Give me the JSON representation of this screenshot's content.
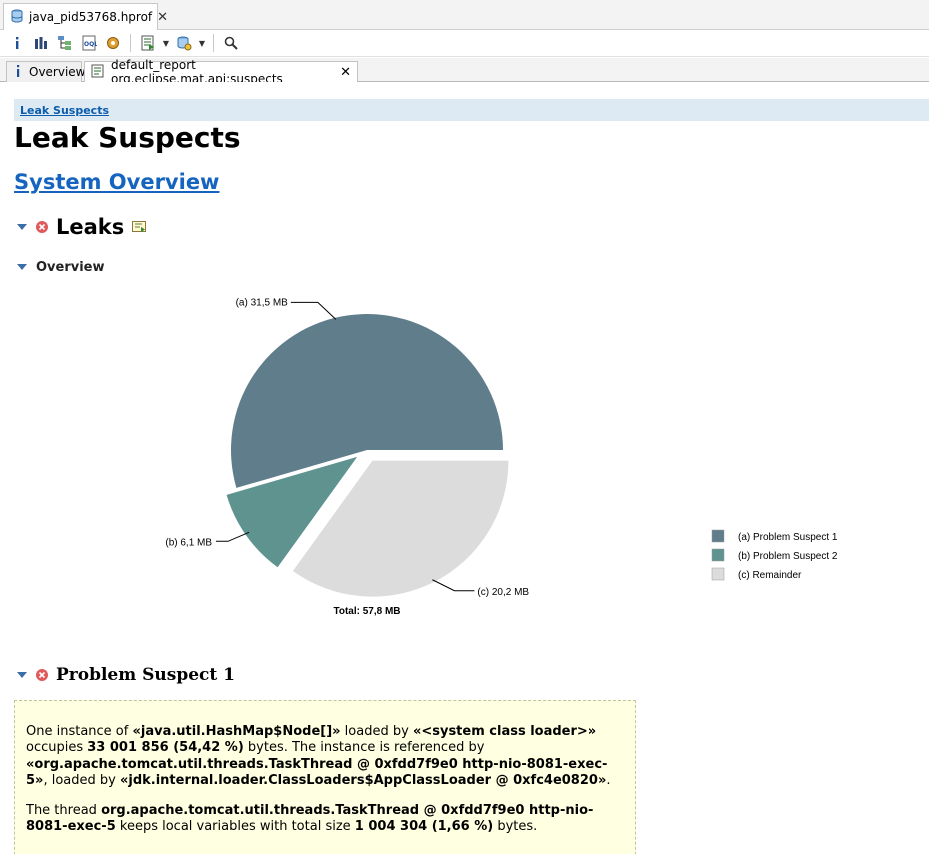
{
  "editor_tab": {
    "label": "java_pid53768.hprof",
    "close_glyph": "✕"
  },
  "toolbar": {
    "buttons": [
      "info-icon",
      "histogram-icon",
      "dominator-tree-icon",
      "oql-icon",
      "thread-overview-icon",
      "run-report-icon",
      "query-browser-icon",
      "search-icon"
    ]
  },
  "subtabs": [
    {
      "label": "Overview"
    },
    {
      "label": "default_report org.eclipse.mat.api:suspects"
    }
  ],
  "breadcrumb": "Leak Suspects",
  "page_title": "Leak Suspects",
  "system_overview_link": "System Overview",
  "sections": {
    "leaks": "Leaks",
    "overview": "Overview",
    "problem_suspect_1": "Problem Suspect 1"
  },
  "colors": {
    "suspect1": "#607d8b",
    "suspect2": "#5f9390",
    "remainder": "#dcdcdc",
    "link": "#1565c0",
    "info_box": "#ffffe1",
    "error_icon": "#e05a5a"
  },
  "chart_data": {
    "type": "pie",
    "slices": [
      {
        "key": "(a)",
        "name": "Problem Suspect 1",
        "value": 31.5,
        "label": "31,5 MB"
      },
      {
        "key": "(b)",
        "name": "Problem Suspect 2",
        "value": 6.1,
        "label": "6,1 MB"
      },
      {
        "key": "(c)",
        "name": "Remainder",
        "value": 20.2,
        "label": "20,2 MB"
      }
    ],
    "total_label": "Total: 57,8 MB",
    "legend": [
      "(a)  Problem Suspect 1",
      "(b)  Problem Suspect 2",
      "(c)  Remainder"
    ],
    "legend_position": "right"
  },
  "description": {
    "p1": [
      {
        "t": "One instance of ",
        "b": false
      },
      {
        "t": "«java.util.HashMap$Node[]»",
        "b": true
      },
      {
        "t": " loaded by ",
        "b": false
      },
      {
        "t": "«<system class loader>»",
        "b": true
      },
      {
        "t": " occupies ",
        "b": false
      },
      {
        "t": "33 001 856 (54,42 %)",
        "b": true
      },
      {
        "t": " bytes. The instance is referenced by ",
        "b": false
      },
      {
        "t": "«org.apache.tomcat.util.threads.TaskThread @ 0xfdd7f9e0 http-nio-8081-exec-5»",
        "b": true
      },
      {
        "t": ", loaded by ",
        "b": false
      },
      {
        "t": "«jdk.internal.loader.ClassLoaders$AppClassLoader @ 0xfc4e0820»",
        "b": true
      },
      {
        "t": ".",
        "b": false
      }
    ],
    "p2": [
      {
        "t": "The thread ",
        "b": false
      },
      {
        "t": "org.apache.tomcat.util.threads.TaskThread @ 0xfdd7f9e0 http-nio-8081-exec-5",
        "b": true
      },
      {
        "t": " keeps local variables with total size ",
        "b": false
      },
      {
        "t": "1 004 304 (1,66 %)",
        "b": true
      },
      {
        "t": " bytes.",
        "b": false
      }
    ]
  }
}
